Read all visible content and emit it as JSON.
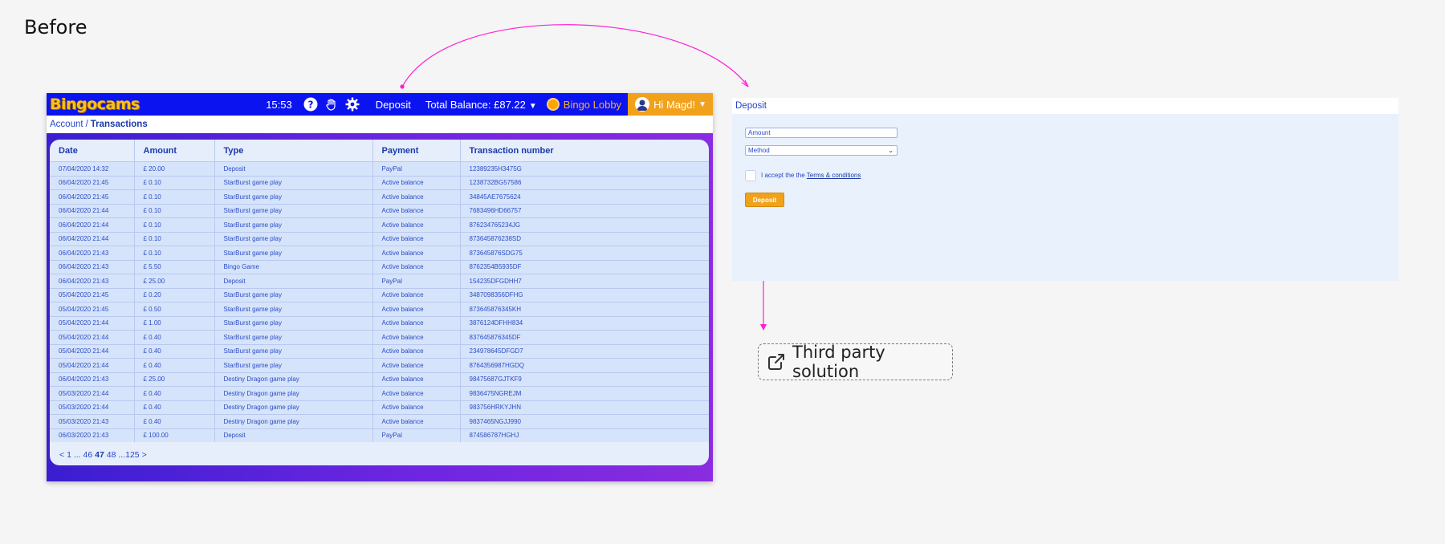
{
  "page_title": "Before",
  "navbar": {
    "logo": "Bingocams",
    "time": "15:53",
    "deposit_label": "Deposit",
    "balance_label": "Total Balance: £87.22",
    "lobby_label": "Bingo Lobby",
    "greeting": "Hi Magd!",
    "brand_color": "#0b14f0",
    "accent_color": "#f2a11b"
  },
  "breadcrumb": {
    "parent": "Account",
    "separator": "/",
    "current": "Transactions"
  },
  "table": {
    "headers": [
      "Date",
      "Amount",
      "Type",
      "Payment",
      "Transaction number"
    ],
    "rows": [
      [
        "07/04/2020 14:32",
        "£ 20.00",
        "Deposit",
        "PayPal",
        "12389235H3475G"
      ],
      [
        "06/04/2020 21:45",
        "£ 0.10",
        "StarBurst game play",
        "Active balance",
        "1238732BG57586"
      ],
      [
        "06/04/2020 21:45",
        "£ 0.10",
        "StarBurst game play",
        "Active balance",
        "34845AE7675624"
      ],
      [
        "06/04/2020 21:44",
        "£ 0.10",
        "StarBurst game play",
        "Active balance",
        "7683496HD66757"
      ],
      [
        "06/04/2020 21:44",
        "£ 0.10",
        "StarBurst game play",
        "Active balance",
        "876234765234JG"
      ],
      [
        "06/04/2020 21:44",
        "£ 0.10",
        "StarBurst game play",
        "Active balance",
        "873645876238SD"
      ],
      [
        "06/04/2020 21:43",
        "£ 0.10",
        "StarBurst game play",
        "Active balance",
        "873645876SDG75"
      ],
      [
        "06/04/2020 21:43",
        "£ 5.50",
        "Bingo Game",
        "Active balance",
        "8762354B5935DF"
      ],
      [
        "06/04/2020 21:43",
        "£ 25.00",
        "Deposit",
        "PayPal",
        "154235DFGDHH7"
      ],
      [
        "05/04/2020 21:45",
        "£ 0.20",
        "StarBurst game play",
        "Active balance",
        "3487098356DFHG"
      ],
      [
        "05/04/2020 21:45",
        "£ 0.50",
        "StarBurst game play",
        "Active balance",
        "873645876345KH"
      ],
      [
        "05/04/2020 21:44",
        "£ 1.00",
        "StarBurst game play",
        "Active balance",
        "3876124DFHH834"
      ],
      [
        "05/04/2020 21:44",
        "£ 0.40",
        "StarBurst game play",
        "Active balance",
        "837645876345DF"
      ],
      [
        "05/04/2020 21:44",
        "£ 0.40",
        "StarBurst game play",
        "Active balance",
        "234978645DFGD7"
      ],
      [
        "05/04/2020 21:44",
        "£ 0.40",
        "StarBurst game play",
        "Active balance",
        "8764356987HGDQ"
      ],
      [
        "06/04/2020 21:43",
        "£ 25.00",
        "Destiny Dragon game play",
        "Active balance",
        "98475687GJTKF9"
      ],
      [
        "05/03/2020 21:44",
        "£ 0.40",
        "Destiny Dragon game play",
        "Active balance",
        "9836475NGREJM"
      ],
      [
        "05/03/2020 21:44",
        "£ 0.40",
        "Destiny Dragon game play",
        "Active balance",
        "983756HRKYJHN"
      ],
      [
        "05/03/2020 21:43",
        "£ 0.40",
        "Destiny Dragon game play",
        "Active balance",
        "9837465NGJJ990"
      ],
      [
        "06/03/2020 21:43",
        "£ 100.00",
        "Deposit",
        "PayPal",
        "874586787HGHJ"
      ]
    ]
  },
  "pager": {
    "prev": "<",
    "first": "1",
    "ellipsis1": "...",
    "p46": "46",
    "current": "47",
    "p48": "48",
    "ellipsis2": "...",
    "last": "125",
    "next": ">"
  },
  "deposit_panel": {
    "title": "Deposit",
    "amount_placeholder": "Amount",
    "method_placeholder": "Method",
    "terms_prefix": "I accept the the",
    "terms_link": "Terms & conditions",
    "button_label": "Deposit"
  },
  "third_party": {
    "label": "Third party solution",
    "icon": "external-link-icon"
  },
  "connector_color": "#ff1fd0"
}
